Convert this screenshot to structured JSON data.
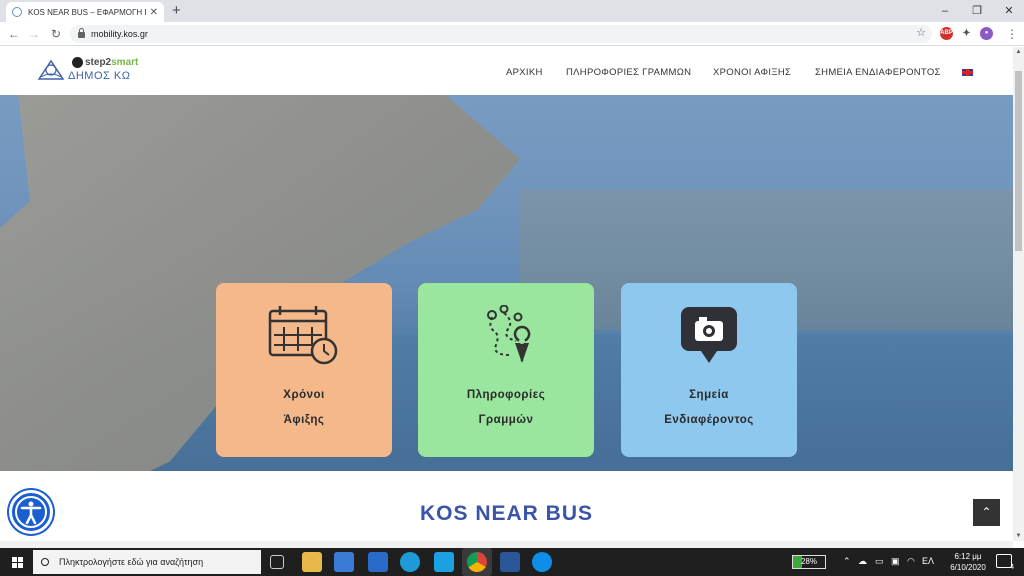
{
  "browser": {
    "tab_title": "KOS NEAR BUS – ΕΦΑΡΜΟΓΗ ΠΛ",
    "new_tab": "+",
    "url": "mobility.kos.gr",
    "window_controls": [
      "–",
      "❐",
      "✕"
    ],
    "extensions": [
      "ABP",
      "puzzle",
      "profile"
    ]
  },
  "site": {
    "logo": {
      "brand_prefix": "step2",
      "brand_suffix": "smart",
      "municipality": "ΔΗΜΟΣ ΚΩ"
    },
    "nav": [
      "ΑΡΧΙΚΗ",
      "ΠΛΗΡΟΦΟΡΙΕΣ ΓΡΑΜΜΩΝ",
      "ΧΡΟΝΟΙ ΑΦΙΞΗΣ",
      "ΣΗΜΕΙΑ ΕΝΔΙΑΦΕΡΟΝΤΟΣ"
    ],
    "language_flag": "uk-flag-icon",
    "cards": [
      {
        "line1": "Χρόνοι",
        "line2": "Άφιξης",
        "color": "#f4b88a",
        "icon": "calendar-clock-icon"
      },
      {
        "line1": "Πληροφορίες",
        "line2": "Γραμμών",
        "color": "#9ae69e",
        "icon": "route-pins-icon"
      },
      {
        "line1": "Σημεία",
        "line2": "Ενδιαφέροντος",
        "color": "#8fc8ef",
        "icon": "camera-pin-icon"
      }
    ],
    "section_title": "KOS NEAR BUS",
    "back_to_top": "⌃",
    "accessibility": "accessibility-icon"
  },
  "taskbar": {
    "search_placeholder": "Πληκτρολογήστε εδώ για αναζήτηση",
    "battery": "28%",
    "language": "ΕΛ",
    "time": "6:12 μμ",
    "date": "6/10/2020",
    "notifications": "4",
    "colors": {
      "taskbar": "#1f1f1f",
      "accent": "#3a55a8"
    }
  }
}
